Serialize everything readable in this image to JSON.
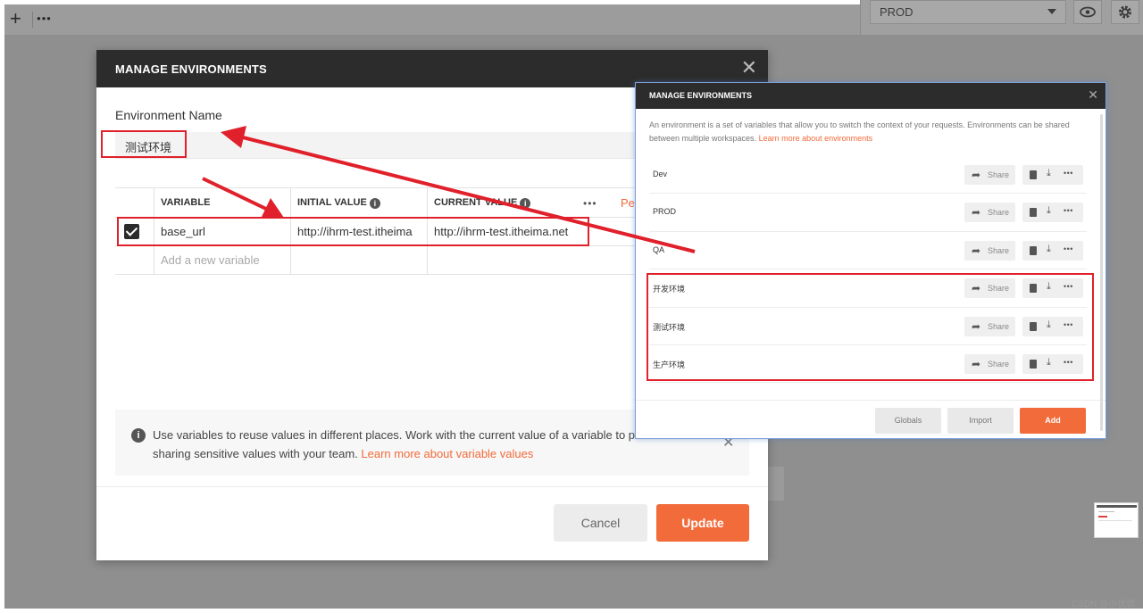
{
  "topbar": {
    "add_label": "+",
    "more_label": "•••",
    "env_selected": "PROD"
  },
  "modal": {
    "title": "MANAGE ENVIRONMENTS",
    "close": "✕",
    "env_name_label": "Environment Name",
    "env_name_value": "测试环境",
    "table": {
      "headers": [
        "VARIABLE",
        "INITIAL VALUE",
        "CURRENT VALUE"
      ],
      "more": "•••",
      "persist_label": "Per",
      "rows": [
        {
          "checked": true,
          "variable": "base_url",
          "initial": "http://ihrm-test.itheima",
          "current": "http://ihrm-test.itheima.net"
        }
      ],
      "add_placeholder": "Add a new variable"
    },
    "info": {
      "text": "Use variables to reuse values in different places. Work with the current value of a variable to p",
      "text2": "sharing sensitive values with your team.",
      "link": "Learn more about variable values",
      "close": "✕"
    },
    "cancel_label": "Cancel",
    "update_label": "Update"
  },
  "overlay": {
    "title": "MANAGE ENVIRONMENTS",
    "close": "✕",
    "desc": "An environment is a set of variables that allow you to switch the context of your requests. Environments can be shared between multiple workspaces.",
    "desc_link": "Learn more about environments",
    "share_label": "Share",
    "more_label": "•••",
    "environments": [
      {
        "name": "Dev"
      },
      {
        "name": "PROD"
      },
      {
        "name": "QA"
      },
      {
        "name": "开发环境"
      },
      {
        "name": "测试环境"
      },
      {
        "name": "生产环境"
      }
    ],
    "globals_label": "Globals",
    "import_label": "Import",
    "add_label": "Add"
  },
  "watermark": "CSDN @小优优",
  "colors": {
    "accent": "#f26b3a",
    "annotation": "#e0202a",
    "header_dark": "#2c2c2c"
  }
}
